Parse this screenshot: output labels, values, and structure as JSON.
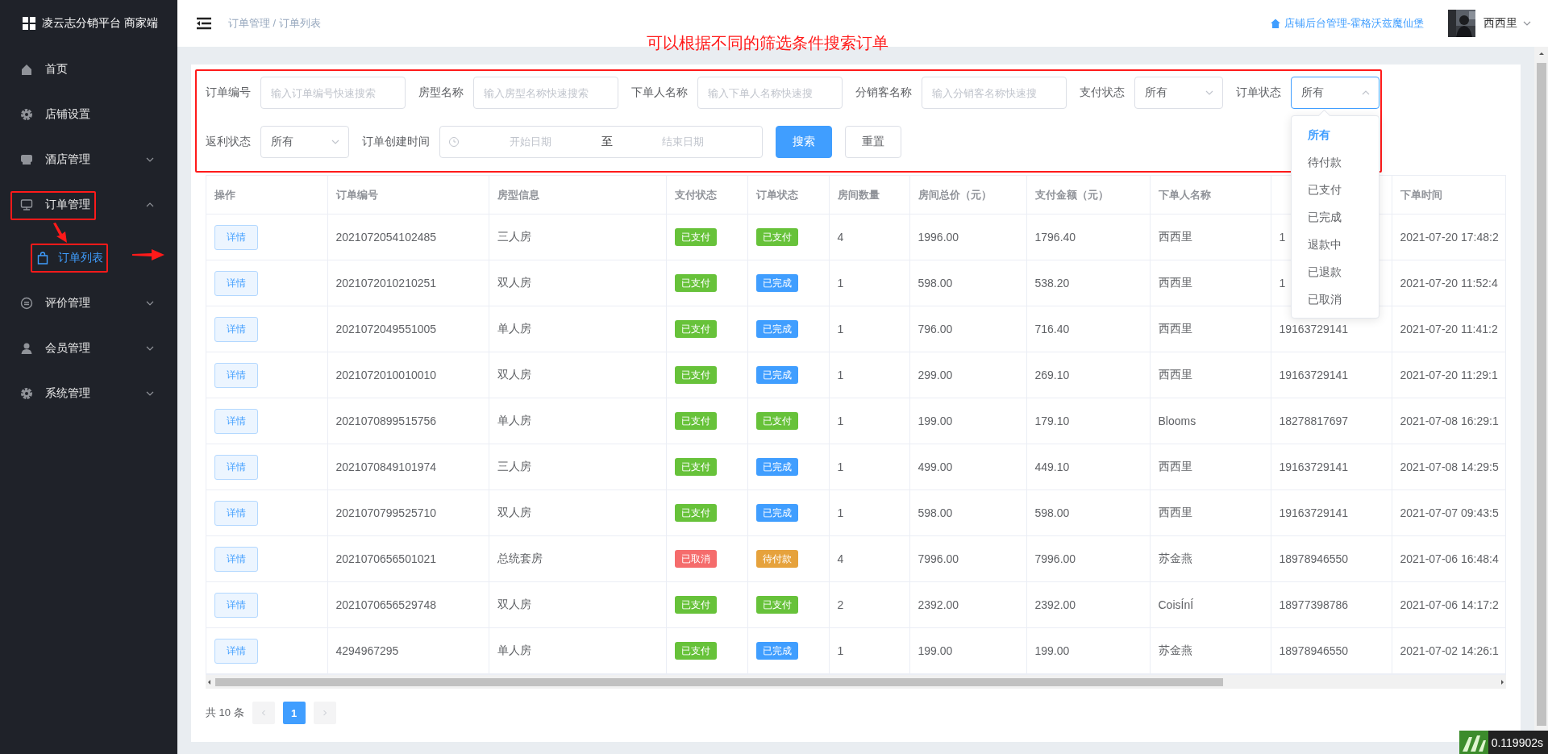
{
  "sidebar": {
    "brand": "凌云志分销平台 商家端",
    "menu": [
      {
        "label": "首页",
        "selected": false
      },
      {
        "label": "店铺设置",
        "selected": false
      },
      {
        "label": "酒店管理",
        "selected": false,
        "expanded": false
      },
      {
        "label": "订单管理",
        "selected": false,
        "expanded": true,
        "children": [
          {
            "label": "订单列表",
            "selected": true
          }
        ]
      },
      {
        "label": "评价管理",
        "selected": false,
        "expanded": false
      },
      {
        "label": "会员管理",
        "selected": false,
        "expanded": false
      },
      {
        "label": "系统管理",
        "selected": false,
        "expanded": false
      }
    ]
  },
  "header": {
    "breadcrumb": "订单管理 / 订单列表",
    "shop_link": "店铺后台管理-霍格沃兹魔仙堡",
    "user": "西西里"
  },
  "annotation": {
    "note": "可以根据不同的筛选条件搜索订单"
  },
  "filter_rows": [
    [
      {
        "kind": "input",
        "label": "订单编号",
        "placeholder": "输入订单编号快速搜索"
      },
      {
        "kind": "input",
        "label": "房型名称",
        "placeholder": "输入房型名称快速搜索"
      },
      {
        "kind": "input",
        "label": "下单人名称",
        "placeholder": "输入下单人名称快速搜"
      },
      {
        "kind": "input",
        "label": "分销客名称",
        "placeholder": "输入分销客名称快速搜"
      },
      {
        "kind": "select",
        "label": "支付状态",
        "value": "所有",
        "expanded": false
      },
      {
        "kind": "select",
        "label": "订单状态",
        "value": "所有",
        "expanded": true,
        "options": [
          {
            "label": "所有",
            "selected": true
          },
          {
            "label": "待付款",
            "selected": false
          },
          {
            "label": "已支付",
            "selected": false
          },
          {
            "label": "已完成",
            "selected": false
          },
          {
            "label": "退款中",
            "selected": false
          },
          {
            "label": "已退款",
            "selected": false
          },
          {
            "label": "已取消",
            "selected": false
          }
        ]
      }
    ],
    [
      {
        "kind": "select",
        "label": "返利状态",
        "value": "所有",
        "expanded": false
      },
      {
        "kind": "daterange",
        "label": "订单创建时间",
        "start_placeholder": "开始日期",
        "separator": "至",
        "end_placeholder": "结束日期"
      },
      {
        "kind": "primary-button",
        "label": "搜索"
      },
      {
        "kind": "button",
        "label": "重置"
      }
    ]
  ],
  "table": {
    "columns": [
      {
        "label": "操作"
      },
      {
        "label": "订单编号"
      },
      {
        "label": "房型信息"
      },
      {
        "label": "支付状态"
      },
      {
        "label": "订单状态"
      },
      {
        "label": "房间数量"
      },
      {
        "label": "房间总价（元）"
      },
      {
        "label": "支付金额（元）"
      },
      {
        "label": "下单人名称"
      },
      {},
      {
        "label": "下单时间"
      }
    ],
    "rows": [
      {
        "action": "详情",
        "order_no": "2021072054102485",
        "room_type": "三人房",
        "pay_status": {
          "text": "已支付",
          "color": "#67c23a"
        },
        "order_status": {
          "text": "已支付",
          "color": "#67c23a"
        },
        "rooms": "4",
        "total": "1996.00",
        "paid": "1796.40",
        "buyer": "西西里",
        "phone": "1",
        "time": "2021-07-20 17:48:2"
      },
      {
        "action": "详情",
        "order_no": "2021072010210251",
        "room_type": "双人房",
        "pay_status": {
          "text": "已支付",
          "color": "#67c23a"
        },
        "order_status": {
          "text": "已完成",
          "color": "#409eff"
        },
        "rooms": "1",
        "total": "598.00",
        "paid": "538.20",
        "buyer": "西西里",
        "phone": "1",
        "time": "2021-07-20 11:52:4"
      },
      {
        "action": "详情",
        "order_no": "2021072049551005",
        "room_type": "单人房",
        "pay_status": {
          "text": "已支付",
          "color": "#67c23a"
        },
        "order_status": {
          "text": "已完成",
          "color": "#409eff"
        },
        "rooms": "1",
        "total": "796.00",
        "paid": "716.40",
        "buyer": "西西里",
        "phone": "19163729141",
        "time": "2021-07-20 11:41:2"
      },
      {
        "action": "详情",
        "order_no": "2021072010010010",
        "room_type": "双人房",
        "pay_status": {
          "text": "已支付",
          "color": "#67c23a"
        },
        "order_status": {
          "text": "已完成",
          "color": "#409eff"
        },
        "rooms": "1",
        "total": "299.00",
        "paid": "269.10",
        "buyer": "西西里",
        "phone": "19163729141",
        "time": "2021-07-20 11:29:1"
      },
      {
        "action": "详情",
        "order_no": "2021070899515756",
        "room_type": "单人房",
        "pay_status": {
          "text": "已支付",
          "color": "#67c23a"
        },
        "order_status": {
          "text": "已支付",
          "color": "#67c23a"
        },
        "rooms": "1",
        "total": "199.00",
        "paid": "179.10",
        "buyer": "Blooms",
        "phone": "18278817697",
        "time": "2021-07-08 16:29:1"
      },
      {
        "action": "详情",
        "order_no": "2021070849101974",
        "room_type": "三人房",
        "pay_status": {
          "text": "已支付",
          "color": "#67c23a"
        },
        "order_status": {
          "text": "已完成",
          "color": "#409eff"
        },
        "rooms": "1",
        "total": "499.00",
        "paid": "449.10",
        "buyer": "西西里",
        "phone": "19163729141",
        "time": "2021-07-08 14:29:5"
      },
      {
        "action": "详情",
        "order_no": "2021070799525710",
        "room_type": "双人房",
        "pay_status": {
          "text": "已支付",
          "color": "#67c23a"
        },
        "order_status": {
          "text": "已完成",
          "color": "#409eff"
        },
        "rooms": "1",
        "total": "598.00",
        "paid": "598.00",
        "buyer": "西西里",
        "phone": "19163729141",
        "time": "2021-07-07 09:43:5"
      },
      {
        "action": "详情",
        "order_no": "2021070656501021",
        "room_type": "总统套房",
        "pay_status": {
          "text": "已取消",
          "color": "#f56c6c"
        },
        "order_status": {
          "text": "待付款",
          "color": "#e6a23c"
        },
        "rooms": "4",
        "total": "7996.00",
        "paid": "7996.00",
        "buyer": "苏金燕",
        "phone": "18978946550",
        "time": "2021-07-06 16:48:4"
      },
      {
        "action": "详情",
        "order_no": "2021070656529748",
        "room_type": "双人房",
        "pay_status": {
          "text": "已支付",
          "color": "#67c23a"
        },
        "order_status": {
          "text": "已支付",
          "color": "#67c23a"
        },
        "rooms": "2",
        "total": "2392.00",
        "paid": "2392.00",
        "buyer": "CoisÍnÍ",
        "phone": "18977398786",
        "time": "2021-07-06 14:17:2"
      },
      {
        "action": "详情",
        "order_no": "4294967295",
        "room_type": "单人房",
        "pay_status": {
          "text": "已支付",
          "color": "#67c23a"
        },
        "order_status": {
          "text": "已完成",
          "color": "#409eff"
        },
        "rooms": "1",
        "total": "199.00",
        "paid": "199.00",
        "buyer": "苏金燕",
        "phone": "18978946550",
        "time": "2021-07-02 14:26:1"
      }
    ]
  },
  "pagination": {
    "total": "共 10 条",
    "pages": [
      {
        "label": "1",
        "selected": true
      }
    ]
  },
  "debug": {
    "timing": "0.119902s"
  }
}
